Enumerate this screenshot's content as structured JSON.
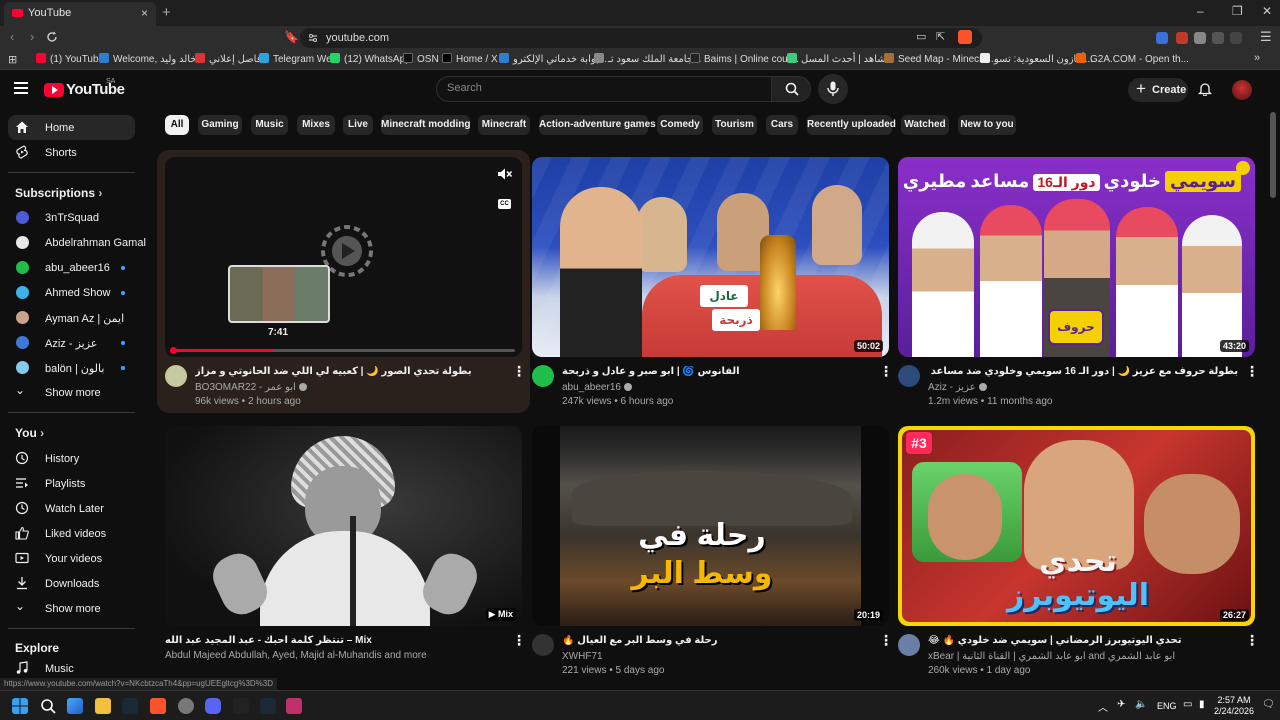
{
  "browser": {
    "tab_title": "YouTube",
    "close_glyph": "×",
    "new_tab_glyph": "+",
    "window_controls": [
      "–",
      "❐",
      "✕"
    ],
    "url": "youtube.com",
    "bookmarks": [
      {
        "label": "(1) YouTube",
        "color": "#ff0033"
      },
      {
        "label": "Welcome, خالد وليد...",
        "color": "#2e7dd1"
      },
      {
        "label": "فاصل إعلاني",
        "color": "#d33"
      },
      {
        "label": "Telegram Web",
        "color": "#2aa3df"
      },
      {
        "label": "(12) WhatsApp",
        "color": "#25d366"
      },
      {
        "label": "OSN",
        "color": "#111"
      },
      {
        "label": "Home / X",
        "color": "#000"
      },
      {
        "label": "بوابة خدماتي الإلكترو...",
        "color": "#2e7dd1"
      },
      {
        "label": "جامعة الملك سعود تـ...",
        "color": "#888"
      },
      {
        "label": "Baims | Online cour...",
        "color": "#222"
      },
      {
        "label": "شاهد | أحدث المسل...",
        "color": "#3ccb7f"
      },
      {
        "label": "Seed Map - Minecra...",
        "color": "#a4703a"
      },
      {
        "label": "أمازون السعودية: تسو...",
        "color": "#eee"
      },
      {
        "label": "G2A.COM - Open th...",
        "color": "#f05f00"
      }
    ]
  },
  "header": {
    "logo_text": "YouTube",
    "country_code": "SA",
    "search_placeholder": "Search",
    "create_label": "Create",
    "create_glyph": "+"
  },
  "sidebar": {
    "main": [
      {
        "label": "Home",
        "icon": "home-icon",
        "active": true
      },
      {
        "label": "Shorts",
        "icon": "shorts-icon",
        "active": false
      }
    ],
    "subscriptions_heading": "Subscriptions",
    "subscriptions": [
      {
        "label": "3nTrSquad",
        "color": "#4b5bd6",
        "live": false
      },
      {
        "label": "Abdelrahman Gamal",
        "color": "#e8e8e8",
        "live": false
      },
      {
        "label": "abu_abeer16",
        "color": "#1fbf4a",
        "live": true
      },
      {
        "label": "Ahmed Show",
        "color": "#3bb3e8",
        "live": true
      },
      {
        "label": "Ayman Az | ايمن",
        "color": "#c9a38b",
        "live": false
      },
      {
        "label": "Aziz - عزيز",
        "color": "#3d7ad6",
        "live": true
      },
      {
        "label": "balön | بالون",
        "color": "#86c9ef",
        "live": true
      }
    ],
    "show_more_1": "Show more",
    "you_heading": "You",
    "you_items": [
      {
        "label": "History",
        "icon": "history-icon"
      },
      {
        "label": "Playlists",
        "icon": "playlists-icon"
      },
      {
        "label": "Watch Later",
        "icon": "watch-later-icon"
      },
      {
        "label": "Liked videos",
        "icon": "liked-videos-icon"
      },
      {
        "label": "Your videos",
        "icon": "your-videos-icon"
      },
      {
        "label": "Downloads",
        "icon": "downloads-icon"
      }
    ],
    "show_more_2": "Show more",
    "explore_heading": "Explore",
    "explore_items": [
      {
        "label": "Music",
        "icon": "music-icon"
      }
    ]
  },
  "chips": [
    "All",
    "Gaming",
    "Music",
    "Mixes",
    "Live",
    "Minecraft modding",
    "Minecraft",
    "Action-adventure games",
    "Comedy",
    "Tourism",
    "Cars",
    "Recently uploaded",
    "Watched",
    "New to you"
  ],
  "selected_chip": "All",
  "videos": [
    {
      "title": "بطولة تحدي الصور 🌙 | كعبيه لي اللي ضد الحانوتي و مزاز",
      "channel": "BO3OMAR22 - ابو عمر",
      "meta": "96k views • 2 hours ago",
      "duration": "",
      "preview_time": "7:41",
      "preview_progress": 0.3,
      "avatar_color": "#c8c8a0"
    },
    {
      "title": "الفانوس 🌀 | ابو صبر و عادل و ذربحة",
      "channel": "abu_abeer16",
      "meta": "247k views • 6 hours ago",
      "duration": "50:02",
      "avatar_color": "#1fbf4a"
    },
    {
      "title": "بطولة حروف مع عزيز 🌙 | دور الـ 16 سويمي وخلودي ضد مساعد والمطيري",
      "channel": "Aziz - عزيز",
      "meta": "1.2m views • 11 months ago",
      "duration": "43:20",
      "avatar_color": "#2c4a7a"
    },
    {
      "title": "Mix – تنتظر كلمة احبك - عبد المجيد عبد الله",
      "channel": "Abdul Majeed Abdullah, Ayed, Majid al-Muhandis and more",
      "meta": "",
      "duration": "Mix",
      "avatar_color": ""
    },
    {
      "title": "رحلة في وسط البر مع العيال 🔥",
      "channel": "XWHF71",
      "meta": "221 views • 5 days ago",
      "duration": "20:19",
      "avatar_color": "#333"
    },
    {
      "title": "تحدي اليوتيوبرز الرمضاني | سويمي ضد خلودي 🔥 😂",
      "channel": "xBear | ابو عابد الشمري | القناة الثانية and ابو عابد الشمري",
      "meta": "260k views • 1 day ago",
      "duration": "26:27",
      "avatar_color": "#6a7fa8"
    }
  ],
  "thumb_text": {
    "v2_sign_1": "عادل",
    "v2_sign_2": "ذربحة",
    "v3_banner_1": "سويمي",
    "v3_banner_2": "خلودي",
    "v3_banner_3": "دور الـ16",
    "v3_banner_4": "مساعد",
    "v3_banner_5": "مطيري",
    "v3_badge": "حروف",
    "v5_line_1": "رحلة في",
    "v5_line_2": "وسط البر",
    "v6_line_1": "تحدي",
    "v6_line_2": "اليوتيوبرز",
    "v6_badge": "#3"
  },
  "status_url": "https://www.youtube.com/watch?v=NKcbtzcaTh4&pp=ugUEEgltcg%3D%3D",
  "taskbar": {
    "lang": "ENG",
    "time": "2:57 AM",
    "date": "2/24/2026"
  }
}
